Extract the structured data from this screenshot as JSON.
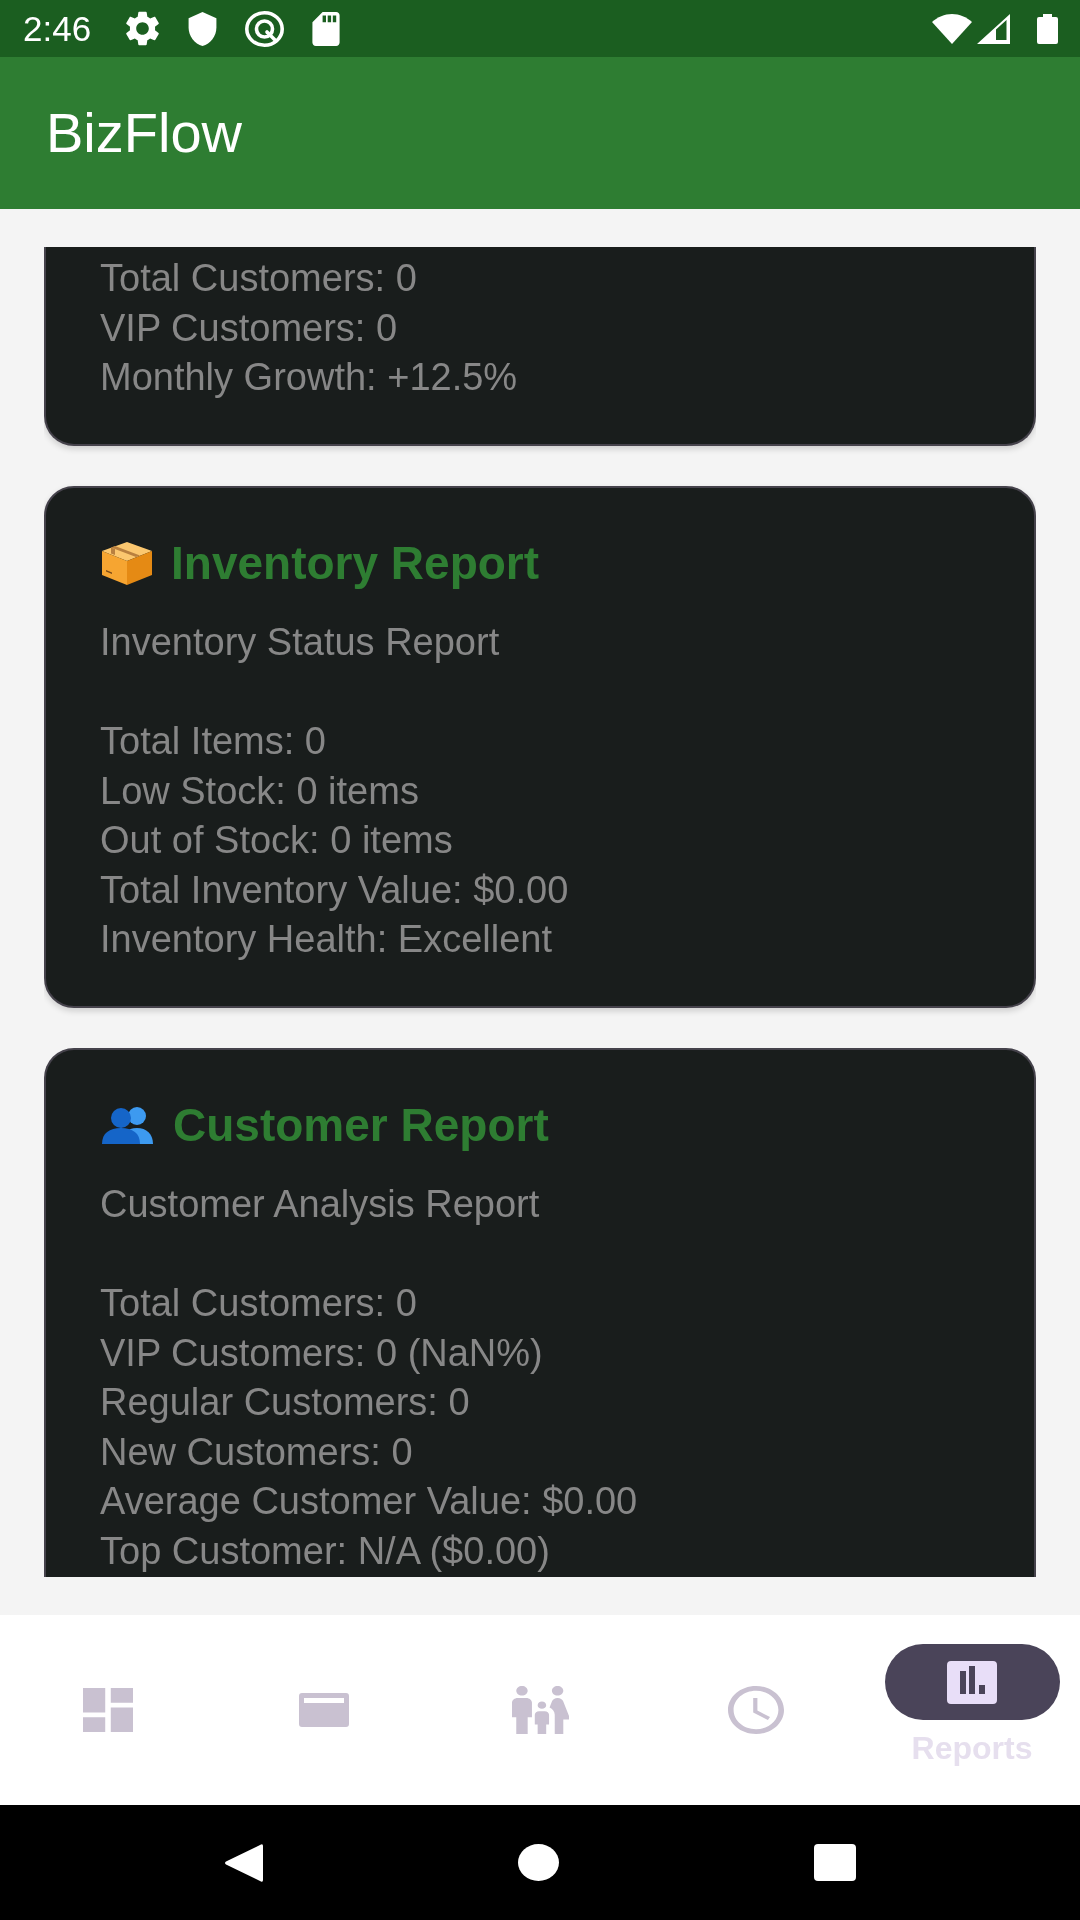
{
  "status_bar": {
    "time": "2:46"
  },
  "app_bar": {
    "title": "BizFlow"
  },
  "report_cards": [
    {
      "lines": [
        "Total Customers: 0",
        "VIP Customers: 0",
        "Monthly Growth: +12.5%"
      ]
    },
    {
      "kind": "inventory",
      "title": "Inventory Report",
      "subtitle": "Inventory Status Report",
      "lines": [
        "Total Items: 0",
        "Low Stock: 0 items",
        "Out of Stock: 0 items",
        "Total Inventory Value: $0.00",
        "Inventory Health: Excellent"
      ]
    },
    {
      "kind": "customers",
      "title": "Customer Report",
      "subtitle": "Customer Analysis Report",
      "lines": [
        "Total Customers: 0",
        "VIP Customers: 0 (NaN%)",
        "Regular Customers: 0",
        "New Customers: 0",
        "Average Customer Value: $0.00",
        "Top Customer: N/A ($0.00)"
      ]
    }
  ],
  "bottom_nav": {
    "items": [
      {
        "selected": false
      },
      {
        "selected": false
      },
      {
        "selected": false
      },
      {
        "selected": false
      },
      {
        "label": "Reports",
        "selected": true
      }
    ]
  }
}
